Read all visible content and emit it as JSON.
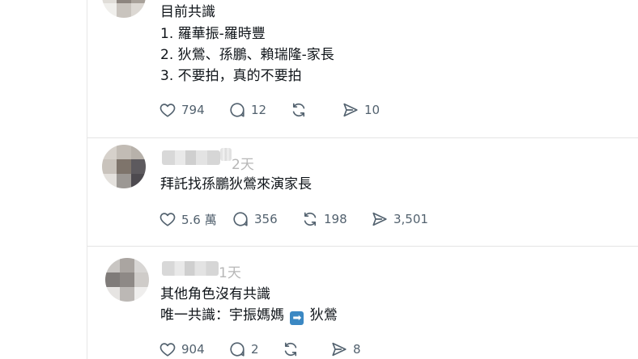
{
  "posts": [
    {
      "lines": [
        "目前共識",
        "1. 羅華振-羅時豐",
        "2. 狄鶯、孫鵬、賴瑞隆-家長",
        "3. 不要拍，真的不要拍"
      ],
      "likes": "794",
      "replies": "12",
      "reposts": "",
      "shares": "10"
    },
    {
      "time": "2天",
      "lines": [
        "拜託找孫鵬狄鶯來演家長"
      ],
      "likes": "5.6 萬",
      "replies": "356",
      "reposts": "198",
      "shares": "3,501"
    },
    {
      "time": "1天",
      "lines": [
        "其他角色沒有共識"
      ],
      "line2_before": "唯一共識：宇振媽媽 ",
      "line2_emoji": "➡",
      "line2_after": " 狄鶯",
      "likes": "904",
      "replies": "2",
      "reposts": "",
      "shares": "8"
    }
  ],
  "icons": {
    "like": "heart-icon",
    "reply": "reply-bubble-icon",
    "repost": "repost-icon",
    "share": "share-send-icon",
    "arrow_emoji": "right-arrow-emoji"
  },
  "colors": {
    "text": "#0f1419",
    "muted": "#53626f",
    "time": "#b7b7b7",
    "divider": "#e4e4e4",
    "emoji_blue": "#3b88c3"
  }
}
